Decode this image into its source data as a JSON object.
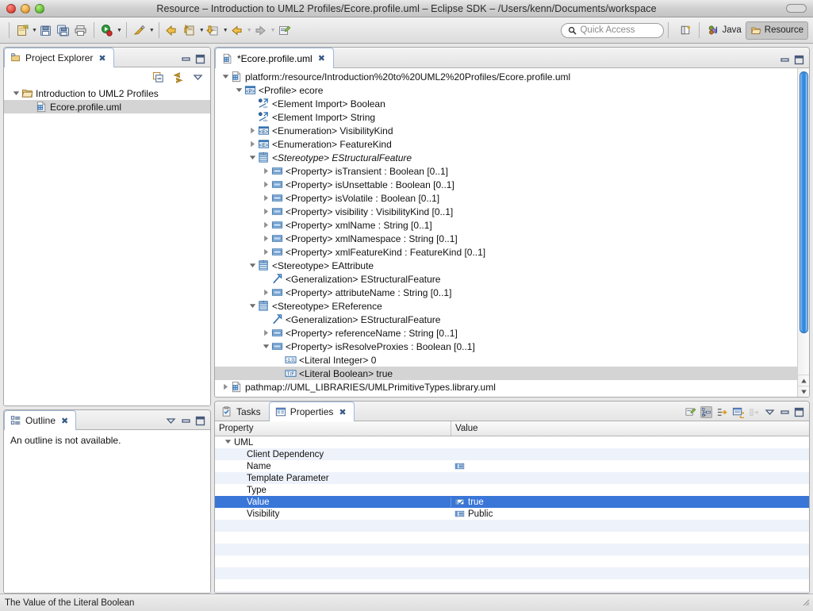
{
  "window": {
    "title": "Resource – Introduction to UML2 Profiles/Ecore.profile.uml – Eclipse SDK – /Users/kenn/Documents/workspace"
  },
  "toolbar": {
    "quick_access_placeholder": "Quick Access",
    "perspectives": [
      {
        "label": "Java",
        "active": false
      },
      {
        "label": "Resource",
        "active": true
      }
    ],
    "buttons": [
      {
        "name": "new-wizard-button",
        "has_arrow": true
      },
      {
        "name": "save-button",
        "has_arrow": false
      },
      {
        "name": "save-all-button",
        "has_arrow": false
      },
      {
        "name": "print-button",
        "has_arrow": false
      },
      {
        "name": "run-button",
        "has_arrow": true
      },
      {
        "name": "debug-button",
        "has_arrow": true
      },
      {
        "name": "back-button",
        "has_arrow": false
      },
      {
        "name": "forward-history-button",
        "has_arrow": true
      },
      {
        "name": "download-button",
        "has_arrow": true
      },
      {
        "name": "previous-annotation-button",
        "has_arrow": true
      },
      {
        "name": "next-annotation-button",
        "has_arrow": true
      },
      {
        "name": "new-untitled-text-file-button",
        "has_arrow": false
      }
    ]
  },
  "project_explorer": {
    "tab_label": "Project Explorer",
    "items": [
      {
        "label": "Introduction to UML2 Profiles",
        "icon": "project-folder-icon",
        "indent": 0,
        "twist": "open",
        "selected": false
      },
      {
        "label": "Ecore.profile.uml",
        "icon": "uml-file-icon",
        "indent": 1,
        "twist": "none",
        "selected": true
      }
    ]
  },
  "outline": {
    "tab_label": "Outline",
    "message": "An outline is not available."
  },
  "editor": {
    "tab_label": "*Ecore.profile.uml",
    "items": [
      {
        "label": "platform:/resource/Introduction%20to%20UML2%20Profiles/Ecore.profile.uml",
        "icon": "uml-file-icon",
        "indent": 0,
        "twist": "open",
        "selected": false,
        "italic": false
      },
      {
        "label": "<Profile> ecore",
        "icon": "profile-icon",
        "indent": 1,
        "twist": "open",
        "selected": false,
        "italic": false
      },
      {
        "label": "<Element Import> Boolean",
        "icon": "element-import-icon",
        "indent": 2,
        "twist": "none",
        "selected": false,
        "italic": false
      },
      {
        "label": "<Element Import> String",
        "icon": "element-import-icon",
        "indent": 2,
        "twist": "none",
        "selected": false,
        "italic": false
      },
      {
        "label": "<Enumeration> VisibilityKind",
        "icon": "enumeration-icon",
        "indent": 2,
        "twist": "closed",
        "selected": false,
        "italic": false
      },
      {
        "label": "<Enumeration> FeatureKind",
        "icon": "enumeration-icon",
        "indent": 2,
        "twist": "closed",
        "selected": false,
        "italic": false
      },
      {
        "label": "<Stereotype> EStructuralFeature",
        "icon": "stereotype-icon",
        "indent": 2,
        "twist": "open",
        "selected": false,
        "italic": true
      },
      {
        "label": "<Property> isTransient : Boolean [0..1]",
        "icon": "property-icon",
        "indent": 3,
        "twist": "closed",
        "selected": false,
        "italic": false
      },
      {
        "label": "<Property> isUnsettable : Boolean [0..1]",
        "icon": "property-icon",
        "indent": 3,
        "twist": "closed",
        "selected": false,
        "italic": false
      },
      {
        "label": "<Property> isVolatile : Boolean [0..1]",
        "icon": "property-icon",
        "indent": 3,
        "twist": "closed",
        "selected": false,
        "italic": false
      },
      {
        "label": "<Property> visibility : VisibilityKind [0..1]",
        "icon": "property-icon",
        "indent": 3,
        "twist": "closed",
        "selected": false,
        "italic": false
      },
      {
        "label": "<Property> xmlName : String [0..1]",
        "icon": "property-icon",
        "indent": 3,
        "twist": "closed",
        "selected": false,
        "italic": false
      },
      {
        "label": "<Property> xmlNamespace : String [0..1]",
        "icon": "property-icon",
        "indent": 3,
        "twist": "closed",
        "selected": false,
        "italic": false
      },
      {
        "label": "<Property> xmlFeatureKind : FeatureKind [0..1]",
        "icon": "property-icon",
        "indent": 3,
        "twist": "closed",
        "selected": false,
        "italic": false
      },
      {
        "label": "<Stereotype> EAttribute",
        "icon": "stereotype-icon",
        "indent": 2,
        "twist": "open",
        "selected": false,
        "italic": false
      },
      {
        "label": "<Generalization> EStructuralFeature",
        "icon": "generalization-icon",
        "indent": 3,
        "twist": "none",
        "selected": false,
        "italic": false
      },
      {
        "label": "<Property> attributeName : String [0..1]",
        "icon": "property-icon",
        "indent": 3,
        "twist": "closed",
        "selected": false,
        "italic": false
      },
      {
        "label": "<Stereotype> EReference",
        "icon": "stereotype-icon",
        "indent": 2,
        "twist": "open",
        "selected": false,
        "italic": false
      },
      {
        "label": "<Generalization> EStructuralFeature",
        "icon": "generalization-icon",
        "indent": 3,
        "twist": "none",
        "selected": false,
        "italic": false
      },
      {
        "label": "<Property> referenceName : String [0..1]",
        "icon": "property-icon",
        "indent": 3,
        "twist": "closed",
        "selected": false,
        "italic": false
      },
      {
        "label": "<Property> isResolveProxies : Boolean [0..1]",
        "icon": "property-icon",
        "indent": 3,
        "twist": "open",
        "selected": false,
        "italic": false
      },
      {
        "label": "<Literal Integer> 0",
        "icon": "literal-integer-icon",
        "indent": 4,
        "twist": "none",
        "selected": false,
        "italic": false
      },
      {
        "label": "<Literal Boolean> true",
        "icon": "literal-boolean-icon",
        "indent": 4,
        "twist": "none",
        "selected": true,
        "italic": false
      },
      {
        "label": "pathmap://UML_LIBRARIES/UMLPrimitiveTypes.library.uml",
        "icon": "uml-file-icon",
        "indent": 0,
        "twist": "closed",
        "selected": false,
        "italic": false
      }
    ]
  },
  "bottom_panel": {
    "tabs": [
      {
        "label": "Tasks",
        "icon": "tasks-icon",
        "active": false
      },
      {
        "label": "Properties",
        "icon": "properties-icon",
        "active": true
      }
    ],
    "columns": [
      "Property",
      "Value"
    ],
    "group_label": "UML",
    "rows": [
      {
        "property": "Client Dependency",
        "value": "",
        "value_icon": "",
        "selected": false
      },
      {
        "property": "Name",
        "value": "",
        "value_icon": "text-value-icon",
        "selected": false
      },
      {
        "property": "Template Parameter",
        "value": "",
        "value_icon": "",
        "selected": false
      },
      {
        "property": "Type",
        "value": "",
        "value_icon": "",
        "selected": false
      },
      {
        "property": "Value",
        "value": "true",
        "value_icon": "boolean-value-icon",
        "selected": true
      },
      {
        "property": "Visibility",
        "value": "Public",
        "value_icon": "text-value-icon",
        "selected": false
      }
    ]
  },
  "statusbar": {
    "message": "The Value of the Literal Boolean"
  }
}
